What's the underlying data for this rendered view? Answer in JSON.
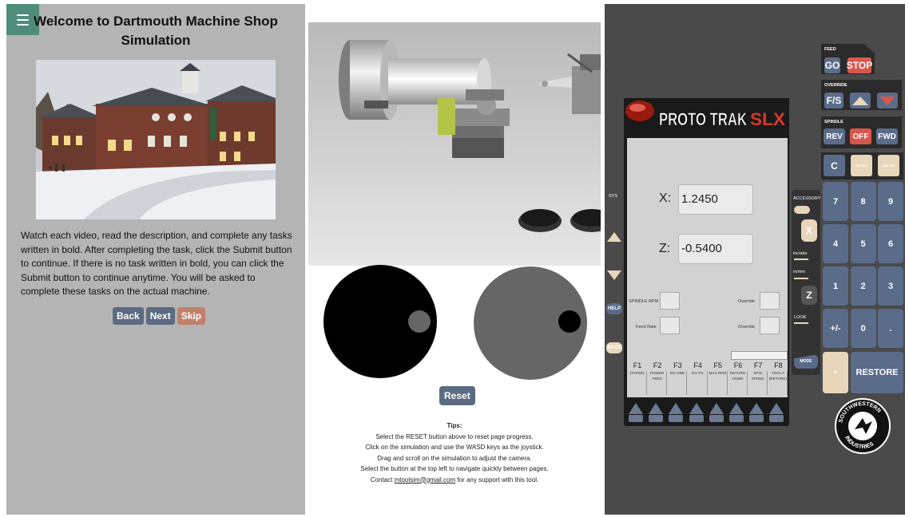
{
  "left": {
    "title": "Welcome to Dartmouth Machine Shop Simulation",
    "description": "Watch each video, read the description, and complete any tasks written in bold. After completing the task, click the Submit button to continue. If there is no task written in bold, you can click the Submit button to continue anytime. You will be asked to complete these tasks on the actual machine.",
    "buttons": {
      "back": "Back",
      "next": "Next",
      "skip": "Skip"
    }
  },
  "middle": {
    "reset_label": "Reset",
    "tips_title": "Tips:",
    "tips": [
      "Select the RESET button above to reset page progress.",
      "Click on the simulation and use the WASD keys as the joystick.",
      "Drag and scroll on the simulation to adjust the camera.",
      "Select the button at the top left to navigate quickly between pages."
    ],
    "contact_prefix": "Contact ",
    "contact_email": "mtoolsim@gmail.com",
    "contact_suffix": " for any support with this tool."
  },
  "controller": {
    "brand": "PROTO TRAK",
    "brand_model": "SLX",
    "x_label": "X:",
    "x_value": "1.2450",
    "z_label": "Z:",
    "z_value": "-0.5400",
    "spindle_rpm_label": "SPINDLE RPM",
    "feed_rate_label": "Feed Rate",
    "override_label_1": "Override",
    "override_label_2": "Override",
    "fkeys": [
      "F1",
      "F2",
      "F3",
      "F4",
      "F5",
      "F6",
      "F7",
      "F8"
    ],
    "fkey_desc": [
      "(TAPER)",
      "POWER FEED",
      "DO ONE",
      "GO TO",
      "MAX RPM",
      "RETURN HOME",
      "SPIN SPEED",
      "TOOL # (RETURN)"
    ],
    "sys_label": "SYS",
    "help_label": "HELP",
    "back_label": "BACK",
    "accessory_label": "ACCESSORY",
    "x_key": "X",
    "z_key": "Z",
    "inc_abs": "inc/abs",
    "in_mm": "in/mm",
    "look": "LOOK",
    "mode": "MODE",
    "feed_label": "FEED",
    "go": "GO",
    "stop": "STOP",
    "override_label": "OVERRIDE",
    "fs": "F/S",
    "spindle_label": "SPINDLE",
    "rev": "REV",
    "off": "OFF",
    "fwd": "FWD",
    "c_key": "C",
    "inc_set": "INC SET",
    "abs_set": "ABS SET",
    "keys": [
      "7",
      "8",
      "9",
      "4",
      "5",
      "6",
      "1",
      "2",
      "3",
      "+/-",
      "0",
      "."
    ],
    "restore": "RESTORE",
    "logo_text_top": "SOUTHWESTERN",
    "logo_text_bottom": "INDUSTRIES"
  }
}
